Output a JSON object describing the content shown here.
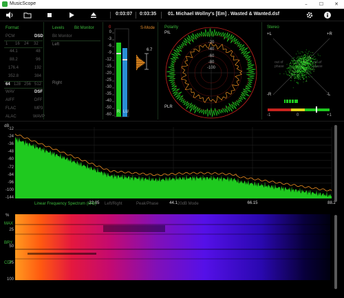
{
  "window": {
    "title": "MusicScope",
    "min": "–",
    "max": "☐",
    "close": "✕"
  },
  "toolbar": {
    "time_elapsed": "0:03:07",
    "time_total": "0:03:35",
    "track": "01. Michael Wollny's [Em] . Wasted & Wanted.dsf",
    "icons": [
      "volume-icon",
      "folder-icon",
      "stop-icon",
      "play-icon",
      "eject-icon",
      "settings-icon",
      "info-icon"
    ]
  },
  "format": {
    "title": "Format",
    "pcm_label": "PCM",
    "dsd_label": "DSD",
    "bits": [
      "1",
      "16",
      "24",
      "32"
    ],
    "rates_left": [
      "44.1",
      "88.2",
      "176.4",
      "352.8"
    ],
    "rates_right": [
      "48",
      "96",
      "192",
      "384"
    ],
    "dsd_rates": [
      "64",
      "128",
      "256",
      "512"
    ],
    "containers_left": [
      "WAV",
      "AIFF",
      "FLAC",
      "ALAC"
    ],
    "containers_right": [
      "DSF",
      "DFF",
      "MP3",
      "WAVP"
    ]
  },
  "levels": {
    "title": "Levels",
    "mode": "Bit Monitor",
    "bit_monitor": "Bit Monitor",
    "left": "Left",
    "right": "Right"
  },
  "meter": {
    "scale": [
      "0",
      "-3",
      "-6",
      "-9",
      "-12",
      "-15",
      "-20",
      "-25",
      "-30",
      "-35",
      "-40",
      "-50",
      "-60"
    ],
    "red_label": "0",
    "smode": "S-Mode",
    "peak": "6.7",
    "ch_r": "R",
    "ch_lu": "LU",
    "left_level_db": -7,
    "right_level_db": -11
  },
  "polarity": {
    "title": "Polarity",
    "pil": "PIL",
    "plr": "PLR",
    "rings": [
      "-20",
      "-40",
      "-60",
      "-80",
      "-100"
    ]
  },
  "stereo": {
    "title": "Stereo",
    "plus_l": "+L",
    "plus_r": "+R",
    "minus_l": "-R",
    "minus_r": "-L",
    "out_left": "out of phase",
    "out_right": "out of phase",
    "corr_ticks": [
      "-1",
      "0",
      "+1"
    ]
  },
  "spectrum": {
    "unit": "dB",
    "y_ticks": [
      "-12",
      "-24",
      "-36",
      "-48",
      "-60",
      "-72",
      "-84",
      "-96",
      "-100",
      "-144"
    ],
    "x_ticks": [
      "22.05",
      "44.1",
      "66.15",
      "88.2"
    ],
    "label": "Linear Frequency Spectrum (kHz)",
    "modes": [
      "Left/Right",
      "Peak/Phase",
      "-20dB Mode"
    ]
  },
  "spectrogram": {
    "unit": "%",
    "y_ticks": [
      "25",
      "50",
      "75",
      "100"
    ],
    "side_labels": [
      "MAX",
      "BRY",
      "CDF"
    ]
  },
  "colors": {
    "accent_green": "#3dbb3d",
    "spectrum_fill": "#1fc91f",
    "meter_blue": "#2a8fd6",
    "curve_orange": "#f09020",
    "red_ring": "#c8231e"
  }
}
